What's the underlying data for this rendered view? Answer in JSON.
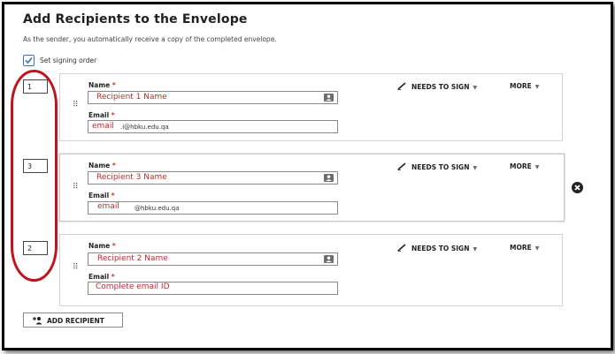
{
  "header": {
    "title": "Add Recipients to the Envelope",
    "subtitle": "As the sender, you automatically receive a copy of the completed envelope."
  },
  "signing_order": {
    "label": "Set signing order",
    "checked": true
  },
  "labels": {
    "name": "Name",
    "email": "Email",
    "required_mark": "*"
  },
  "actions": {
    "needs_to_sign": "NEEDS TO SIGN",
    "more": "MORE"
  },
  "recipients": [
    {
      "order": "1",
      "name": "Recipient 1 Name",
      "email_prefix": "email",
      "email_suffix": ".i@hbku.edu.qa"
    },
    {
      "order": "3",
      "name": "Recipient 3 Name",
      "email_prefix": "email",
      "email_suffix": "@hbku.edu.qa"
    },
    {
      "order": "2",
      "name": "Recipient 2 Name",
      "email_prefix": "Complete email ID",
      "email_suffix": ""
    }
  ],
  "add_button": {
    "label": "ADD RECIPIENT"
  },
  "colors": {
    "annotation_red": "#c0151f",
    "accent_blue": "#3b73b9",
    "text_red": "#b82e2e"
  },
  "icons": [
    "check-icon",
    "drag-handle-icon",
    "contact-card-icon",
    "pen-icon",
    "chevron-down-icon",
    "close-icon",
    "add-person-icon"
  ]
}
